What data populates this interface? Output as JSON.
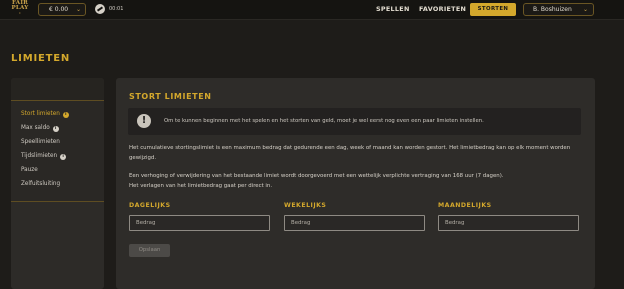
{
  "header": {
    "logo_text": "FAIR PLAY",
    "balance": "€ 0.00",
    "timer": "00:01",
    "nav": [
      "SPELLEN",
      "FAVORIETEN"
    ],
    "deposit_label": "STORTEN",
    "user_name": "B. Boshuizen"
  },
  "page": {
    "title": "LIMIETEN"
  },
  "sidebar": {
    "items": [
      {
        "label": "Stort limieten",
        "info": true,
        "active": true
      },
      {
        "label": "Max saldo",
        "info": true,
        "active": false
      },
      {
        "label": "Speellimieten",
        "info": false,
        "active": false
      },
      {
        "label": "Tijdslimieten",
        "info": true,
        "active": false
      },
      {
        "label": "Pauze",
        "info": false,
        "active": false
      },
      {
        "label": "Zelfuitsluiting",
        "info": false,
        "active": false
      }
    ]
  },
  "main": {
    "title": "STORT LIMIETEN",
    "notice": "Om te kunnen beginnen met het spelen en het storten van geld, moet je wel eerst nog even een paar limieten instellen.",
    "paragraph1": "Het cumulatieve stortingslimiet is een maximum bedrag dat gedurende een dag, week of maand kan worden gestort. Het limietbedrag kan op elk moment worden gewijzigd.",
    "paragraph2a": "Een verhoging of verwijdering van het bestaande limiet wordt doorgevoerd met een wettelijk verplichte vertraging van 168 uur (7 dagen).",
    "paragraph2b": "Het verlagen van het limietbedrag gaat per direct in.",
    "fields": [
      {
        "label": "DAGELIJKS",
        "placeholder": "Bedrag"
      },
      {
        "label": "WEKELIJKS",
        "placeholder": "Bedrag"
      },
      {
        "label": "MAANDELIJKS",
        "placeholder": "Bedrag"
      }
    ],
    "save_label": "Opslaan"
  },
  "colors": {
    "accent": "#d4a82c",
    "background": "#1e1c19",
    "panel": "#2e2c29"
  },
  "icons": {
    "timer": "timer-icon",
    "info": "info-icon",
    "notice": "exclamation-icon",
    "chevron": "chevron-down-icon"
  }
}
